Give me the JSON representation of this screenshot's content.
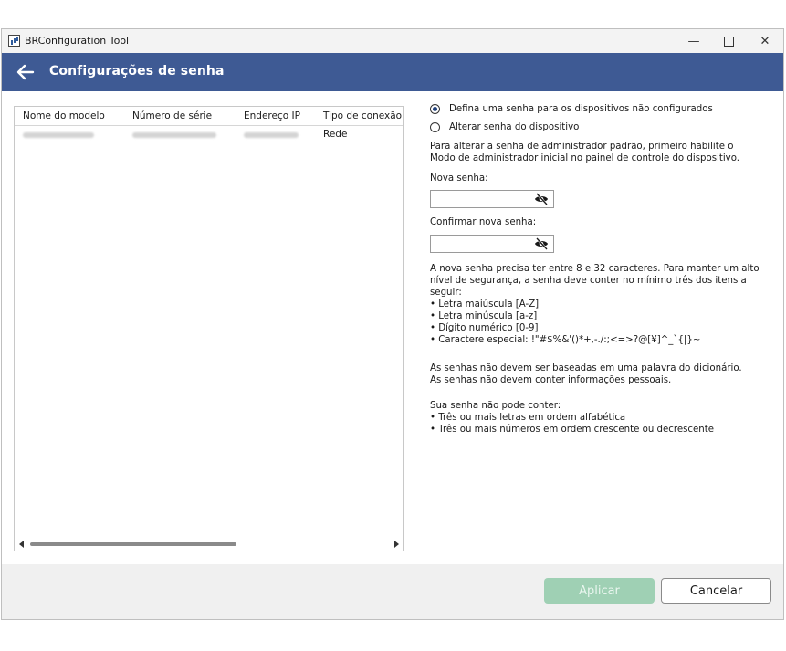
{
  "window": {
    "title": "BRConfiguration Tool"
  },
  "header": {
    "title": "Configurações de senha"
  },
  "table": {
    "columns": [
      "Nome do modelo",
      "Número de série",
      "Endereço IP",
      "Tipo de conexão"
    ],
    "rows": [
      {
        "connection": "Rede"
      }
    ]
  },
  "options": {
    "set_password": "Defina uma senha para os dispositivos não configurados",
    "change_password": "Alterar senha do dispositivo"
  },
  "info": {
    "change_note": "Para alterar a senha de administrador padrão, primeiro habilite o Modo de administrador inicial no painel de controle do dispositivo."
  },
  "fields": {
    "new_password_label": "Nova senha:",
    "confirm_password_label": "Confirmar nova senha:"
  },
  "rules": {
    "intro": "A nova senha precisa ter entre 8 e 32 caracteres. Para manter um alto nível de segurança, a senha deve conter no mínimo três dos itens a seguir:",
    "items": [
      "• Letra maiúscula [A-Z]",
      "• Letra minúscula [a-z]",
      "• Dígito numérico [0-9]",
      "• Caractere especial: !\"#$%&'()*+,-./:;<=>?@[¥]^_`{|}~"
    ],
    "dictionary_note": "As senhas não devem ser baseadas em uma palavra do dicionário.",
    "personal_note": "As senhas não devem conter informações pessoais.",
    "cannot_contain_title": "Sua senha não pode conter:",
    "cannot_contain": [
      "• Três ou mais letras em ordem alfabética",
      "• Três ou mais números em ordem crescente ou decrescente"
    ]
  },
  "buttons": {
    "apply": "Aplicar",
    "cancel": "Cancelar"
  },
  "colors": {
    "header": "#3e5a94",
    "apply_disabled": "#9fd0b4"
  }
}
